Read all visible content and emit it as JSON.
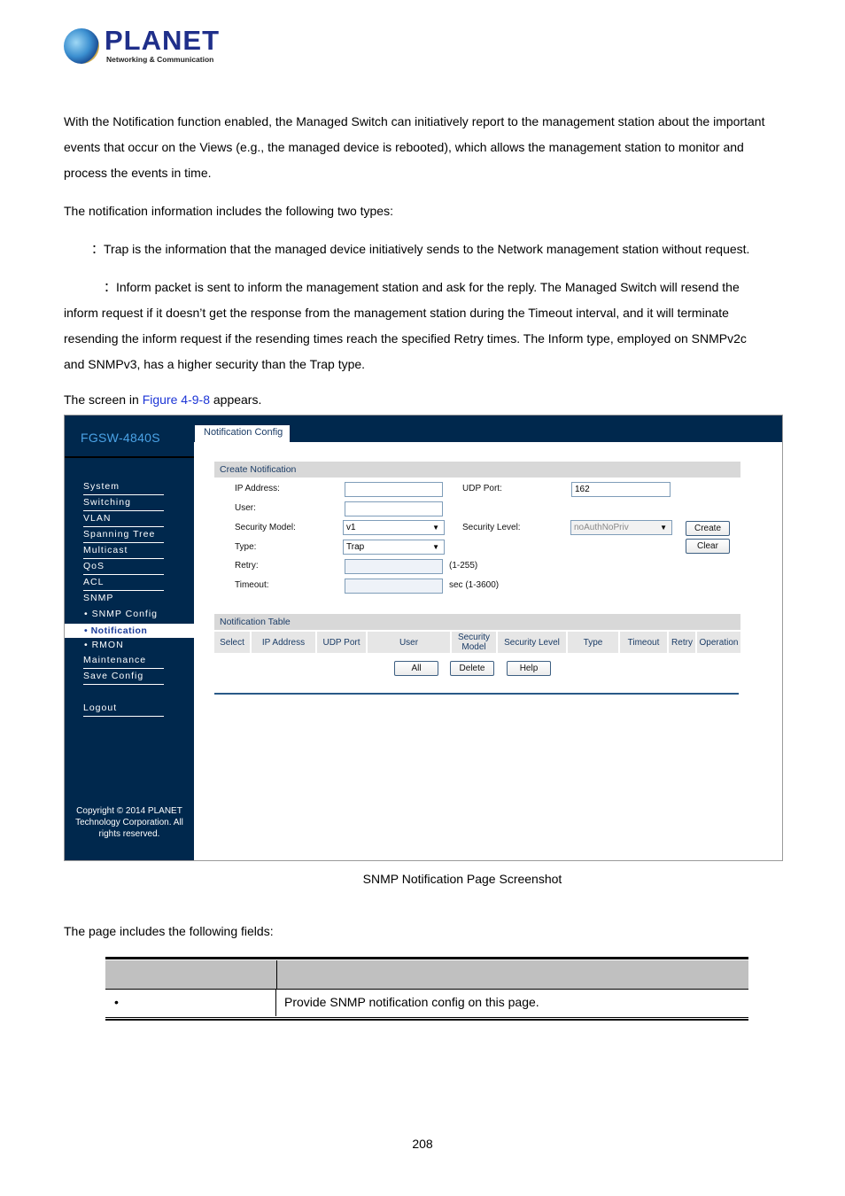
{
  "logo": {
    "name": "PLANET",
    "tagline": "Networking & Communication"
  },
  "intro": {
    "para1_line1": "With the Notification function enabled, the Managed Switch can initiatively report to the management station about the important",
    "para1_line2": "events that occur on the Views (e.g., the managed device is rebooted), which allows the management station to monitor and",
    "para1_line3": "process the events in time.",
    "para2": "The notification information includes the following two types:",
    "trap": "：Trap is the information that the managed device initiatively sends to the Network management station without request.",
    "inform_line1": "：Inform packet is sent to inform the management station and ask for the reply. The Managed Switch will resend the",
    "inform_line2": "inform request if it doesn’t get the response from the management station during the Timeout interval, and it will terminate",
    "inform_line3": "resending the inform request if the resending times reach the specified Retry times. The Inform type, employed on SNMPv2c",
    "inform_line4": "and SNMPv3, has a higher security than the Trap type.",
    "screen_prefix": "The screen in ",
    "figure_link": "Figure 4-9-8",
    "screen_suffix": " appears."
  },
  "screenshot": {
    "model": "FGSW-4840S",
    "tab": "Notification Config",
    "nav": [
      "System",
      "Switching",
      "VLAN",
      "Spanning Tree",
      "Multicast",
      "QoS",
      "ACL",
      "SNMP"
    ],
    "nav_sub": [
      "• SNMP Config",
      "• Notification",
      "• RMON"
    ],
    "nav_bottom": [
      "Maintenance",
      "Save Config",
      "Logout"
    ],
    "copyright": "Copyright © 2014 PLANET Technology Corporation. All rights reserved.",
    "create": {
      "title": "Create Notification",
      "ip_label": "IP Address:",
      "ip_value": "",
      "user_label": "User:",
      "user_value": "",
      "secmodel_label": "Security Model:",
      "secmodel_value": "v1",
      "type_label": "Type:",
      "type_value": "Trap",
      "retry_label": "Retry:",
      "retry_value": "",
      "retry_hint": "(1-255)",
      "timeout_label": "Timeout:",
      "timeout_value": "",
      "timeout_hint": "sec (1-3600)",
      "udp_label": "UDP Port:",
      "udp_value": "162",
      "seclevel_label": "Security Level:",
      "seclevel_value": "noAuthNoPriv",
      "create_btn": "Create",
      "clear_btn": "Clear"
    },
    "table": {
      "title": "Notification Table",
      "columns": [
        "Select",
        "IP Address",
        "UDP Port",
        "User",
        "Security Model",
        "Security Level",
        "Type",
        "Timeout",
        "Retry",
        "Operation"
      ],
      "all_btn": "All",
      "delete_btn": "Delete",
      "help_btn": "Help"
    }
  },
  "caption": "SNMP Notification Page Screenshot",
  "fields_intro": "The page includes the following fields:",
  "fields_table": {
    "headers": [
      "",
      ""
    ],
    "rows": [
      {
        "bullet": "•",
        "desc": "Provide SNMP notification config on this page."
      }
    ]
  },
  "page_number": "208",
  "colors": {
    "nav_bg": "#00284d",
    "model_text": "#4ba3e6",
    "link": "#1c35d6",
    "table_header": "#c0c0c0"
  }
}
